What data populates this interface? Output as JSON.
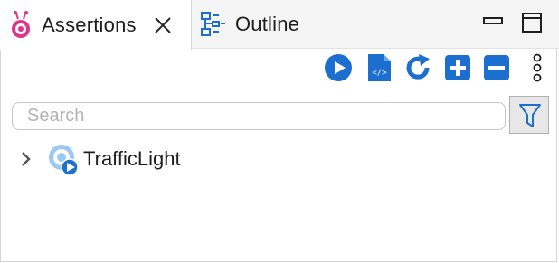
{
  "tabs": [
    {
      "label": "Assertions",
      "icon": "assertions-icon",
      "active": true,
      "close_icon": "close-icon"
    },
    {
      "label": "Outline",
      "icon": "outline-icon",
      "active": false
    }
  ],
  "view_controls": [
    {
      "name": "minimize-icon"
    },
    {
      "name": "maximize-icon"
    }
  ],
  "toolbar": [
    {
      "name": "run-icon"
    },
    {
      "name": "source-file-icon"
    },
    {
      "name": "refresh-icon"
    },
    {
      "name": "expand-all-icon"
    },
    {
      "name": "collapse-all-icon"
    },
    {
      "name": "more-options-icon"
    }
  ],
  "search": {
    "placeholder": "Search",
    "value": ""
  },
  "filter_icon": "filter-icon",
  "tree": [
    {
      "label": "TrafficLight",
      "expanded": false,
      "icon": "traffic-light-model-icon"
    }
  ],
  "colors": {
    "accent": "#1d6fcf",
    "assertions_pink": "#e0338a",
    "light_blue": "#9cc8f4"
  }
}
